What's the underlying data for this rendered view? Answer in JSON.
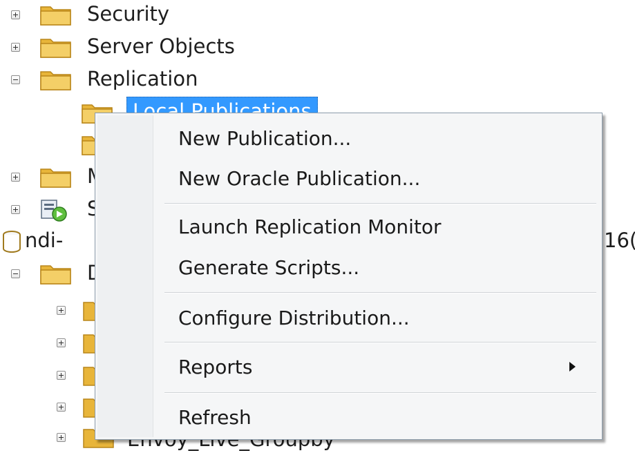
{
  "object_explorer": {
    "nodes": {
      "security": "Security",
      "server_objects": "Server Objects",
      "replication": "Replication",
      "local_publications": "Local Publications",
      "partial_m": "M",
      "partial_s": "S",
      "partial_server": "ndi-",
      "partial_server_suffix": "16(",
      "partial_d": "D",
      "bottom_db": "Envoy_Live_Groupby"
    }
  },
  "context_menu": {
    "items": {
      "new_publication": "New Publication...",
      "new_oracle_publication": "New Oracle Publication...",
      "launch_replication_monitor": "Launch Replication Monitor",
      "generate_scripts": "Generate Scripts...",
      "configure_distribution": "Configure Distribution...",
      "reports": "Reports",
      "refresh": "Refresh"
    }
  },
  "icons": {
    "folder": "folder-icon",
    "expand": "plus-expander-icon",
    "collapse": "minus-expander-icon",
    "database": "database-icon",
    "server": "server-icon",
    "submenu": "submenu-arrow-icon"
  },
  "colors": {
    "selection": "#3399ff",
    "folder": "#f0c14b",
    "menu_background": "#f5f6f7"
  }
}
